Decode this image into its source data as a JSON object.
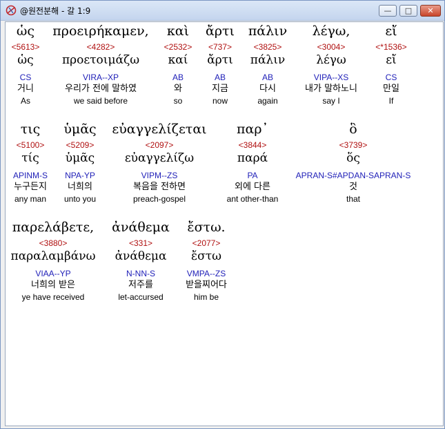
{
  "window": {
    "title": "@원전분해 - 갈 1:9",
    "min_glyph": "—",
    "max_glyph": "□",
    "close_glyph": "✕"
  },
  "rows": [
    [
      {
        "greek": "ὡς",
        "num": "<5613>",
        "lemma": "ὡς",
        "morph": "CS",
        "kor": "거니",
        "eng": "As"
      },
      {
        "greek": "προειρήκαμεν,",
        "num": "<4282>",
        "lemma": "προετοιμάζω",
        "morph": "VIRA--XP",
        "kor": "우리가 전에 말하였",
        "eng": "we said before"
      },
      {
        "greek": "καὶ",
        "num": "<2532>",
        "lemma": "καί",
        "morph": "AB",
        "kor": "와",
        "eng": "so"
      },
      {
        "greek": "ἄρτι",
        "num": "<737>",
        "lemma": "ἄρτι",
        "morph": "AB",
        "kor": "지금",
        "eng": "now"
      },
      {
        "greek": "πάλιν",
        "num": "<3825>",
        "lemma": "πάλιν",
        "morph": "AB",
        "kor": "다시",
        "eng": "again"
      },
      {
        "greek": "λέγω,",
        "num": "<3004>",
        "lemma": "λέγω",
        "morph": "VIPA--XS",
        "kor": "내가 말하노니",
        "eng": "say I"
      },
      {
        "greek": "εἴ",
        "num": "<*1536>",
        "lemma": "εἴ",
        "morph": "CS",
        "kor": "만일",
        "eng": "If"
      }
    ],
    [
      {
        "greek": "τις",
        "num": "<5100>",
        "lemma": "τίς",
        "morph": "APINM-S",
        "kor": "누구든지",
        "eng": "any man"
      },
      {
        "greek": "ὑμᾶς",
        "num": "<5209>",
        "lemma": "ὑμᾶς",
        "morph": "NPA-YP",
        "kor": "너희의",
        "eng": "unto you"
      },
      {
        "greek": "εὐαγγελίζεται",
        "num": "<2097>",
        "lemma": "εὐαγγελίζω",
        "morph": "VIPM--ZS",
        "kor": "복음을 전하면",
        "eng": "preach-gospel"
      },
      {
        "greek": "παρ᾽",
        "num": "<3844>",
        "lemma": "παρά",
        "morph": "PA",
        "kor": "외에 다른",
        "eng": "ant other-than"
      },
      {
        "greek": "ὃ",
        "num": "<3739>",
        "lemma": "ὅς",
        "morph": "APRAN-S#APDAN-SAPRAN-S",
        "kor": "것",
        "eng": "that"
      }
    ],
    [
      {
        "greek": "παρελάβετε,",
        "num": "<3880>",
        "lemma": "παραλαμβάνω",
        "morph": "VIAA--YP",
        "kor": "너희의 받은",
        "eng": "ye have received"
      },
      {
        "greek": "ἀνάθεμα",
        "num": "<331>",
        "lemma": "ἀνάθεμα",
        "morph": "N-NN-S",
        "kor": "저주를",
        "eng": "let-accursed"
      },
      {
        "greek": "ἔστω.",
        "num": "<2077>",
        "lemma": "ἔστω",
        "morph": "VMPA--ZS",
        "kor": "받을찌어다",
        "eng": "him be"
      }
    ]
  ]
}
